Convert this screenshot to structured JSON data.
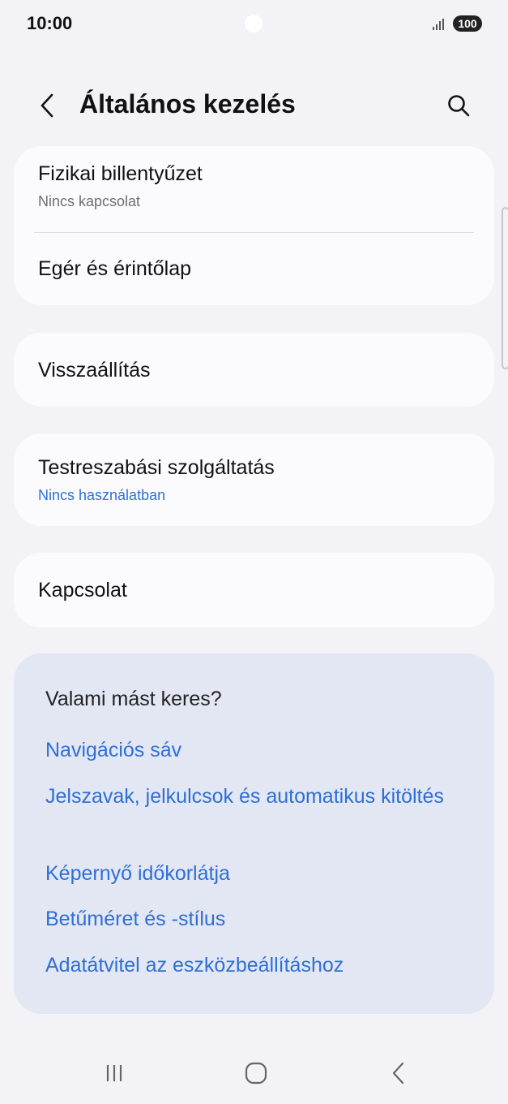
{
  "status_bar": {
    "time": "10:00",
    "battery": "100",
    "icons": [
      "camera-cutout",
      "signal-icon",
      "battery-icon"
    ]
  },
  "header": {
    "title": "Általános kezelés",
    "icons": [
      "back-arrow-icon",
      "search-icon"
    ]
  },
  "groups": [
    {
      "rows": [
        {
          "title": "Fizikai billentyűzet",
          "subtitle": "Nincs kapcsolat"
        },
        {
          "title": "Egér és érintőlap"
        }
      ]
    },
    {
      "rows": [
        {
          "title": "Visszaállítás"
        }
      ]
    },
    {
      "rows": [
        {
          "title": "Testreszabási szolgáltatás",
          "subtitle": "Nincs használatban"
        }
      ]
    },
    {
      "rows": [
        {
          "title": "Kapcsolat"
        }
      ]
    }
  ],
  "suggestions": {
    "heading": "Valami mást keres?",
    "links": [
      "Navigációs sáv",
      "Jelszavak, jelkulcsok és automatikus kitöltés",
      "Képernyő időkorlátja",
      "Betűméret és -stílus",
      "Adatátvitel az eszközbeállításhoz"
    ]
  },
  "nav_bar": {
    "icons": [
      "recents-icon",
      "home-icon",
      "back-icon"
    ]
  },
  "colors": {
    "background": "#f2f2f7",
    "card": "#fbfbfe",
    "suggest_card": "#e3e7f4",
    "accent": "#2f6fd6",
    "secondary_text": "#6e6e73"
  }
}
